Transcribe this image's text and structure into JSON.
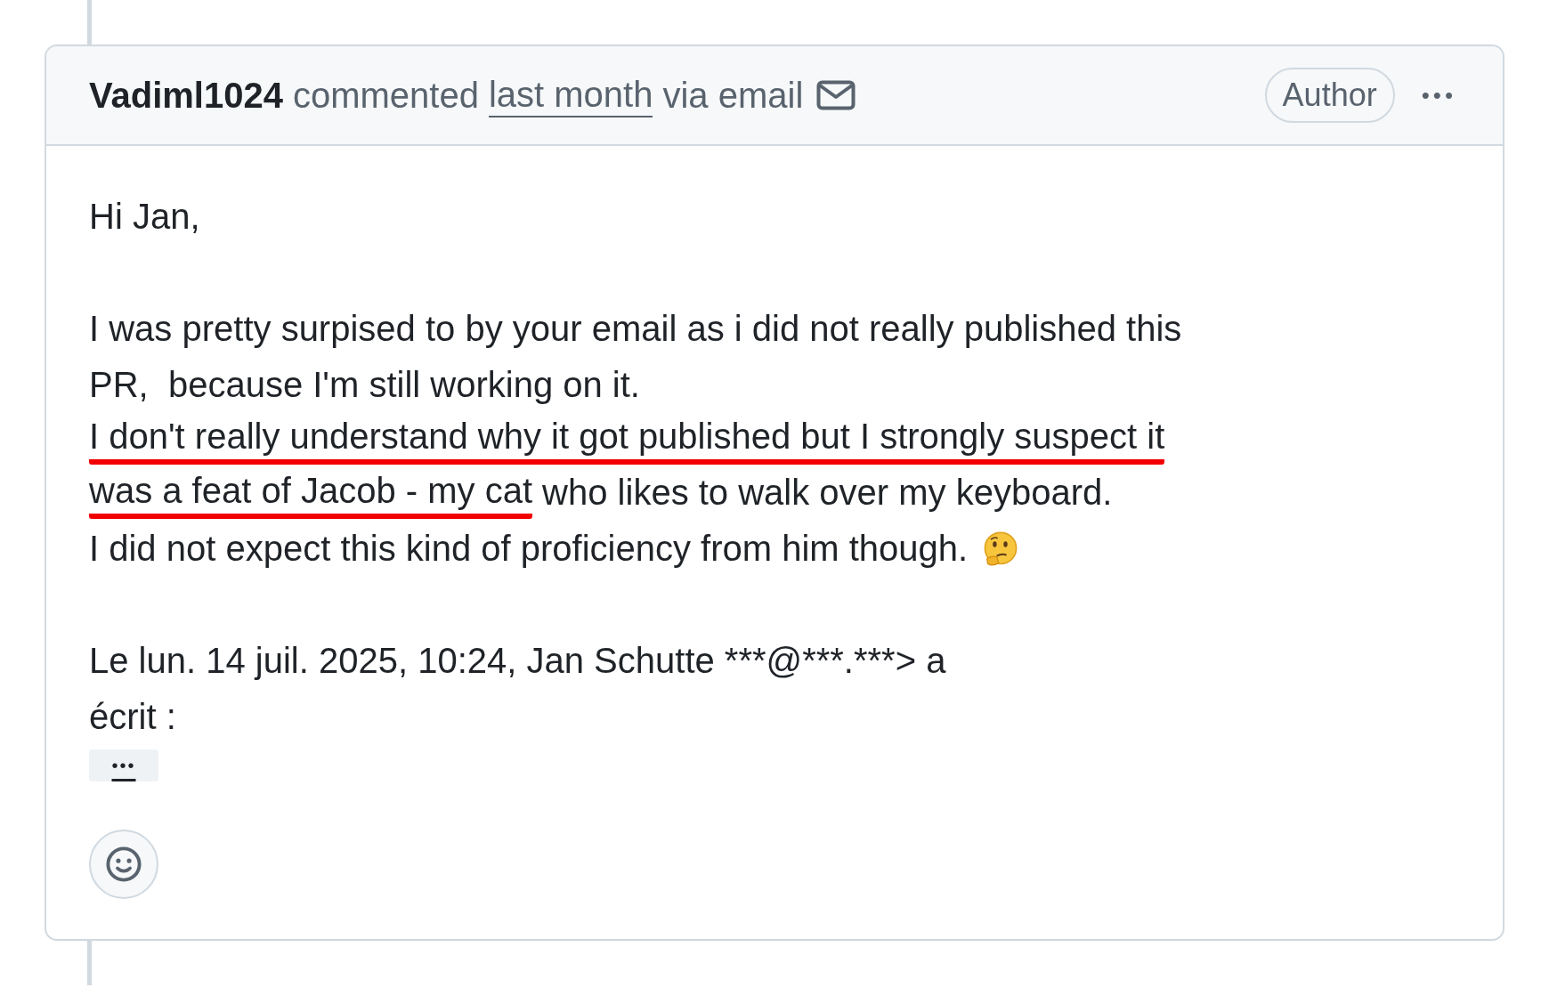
{
  "comment": {
    "author": "Vadiml1024",
    "action": "commented",
    "time": "last month",
    "via": "via email",
    "badge": "Author",
    "menu": "•••",
    "paragraphs": [
      {
        "lines": [
          {
            "text": "Hi Jan,"
          }
        ]
      },
      {
        "lines": [
          {
            "text": "I was pretty surpised to by your email as i did not really published this"
          },
          {
            "text": "PR,  because I'm still working on it."
          },
          {
            "marked": "I don't really understand why it got published but I strongly suspect it"
          },
          {
            "marked": "was a feat of Jacob - my cat",
            "text": " who likes to walk over my keyboard."
          },
          {
            "text": "I did not expect this kind of proficiency from him though.",
            "emoji": true
          }
        ]
      },
      {
        "lines": [
          {
            "text": "Le lun. 14 juil. 2025, 10:24, Jan Schutte ***@***.***> a"
          },
          {
            "text": "écrit :"
          }
        ]
      }
    ],
    "quote_toggle": "•••"
  }
}
